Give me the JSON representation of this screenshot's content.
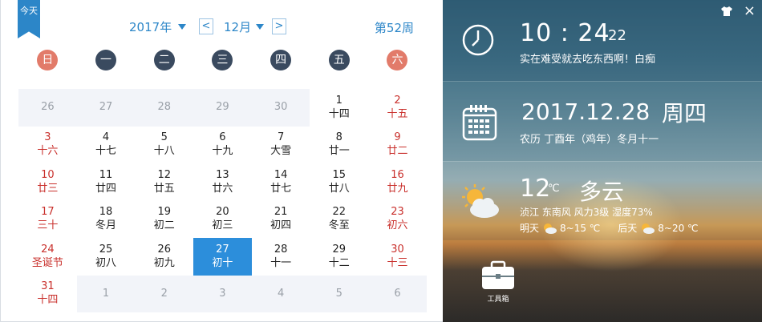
{
  "calendar": {
    "today_label": "今天",
    "year": "2017年",
    "prev": "<",
    "month": "12月",
    "next": ">",
    "week_no": "第52周",
    "weekdays": [
      "日",
      "一",
      "二",
      "三",
      "四",
      "五",
      "六"
    ],
    "cells": [
      {
        "n": "26",
        "l": "",
        "type": "other"
      },
      {
        "n": "27",
        "l": "",
        "type": "other"
      },
      {
        "n": "28",
        "l": "",
        "type": "other"
      },
      {
        "n": "29",
        "l": "",
        "type": "other"
      },
      {
        "n": "30",
        "l": "",
        "type": "other"
      },
      {
        "n": "1",
        "l": "十四",
        "type": "normal"
      },
      {
        "n": "2",
        "l": "十五",
        "type": "red"
      },
      {
        "n": "3",
        "l": "十六",
        "type": "red"
      },
      {
        "n": "4",
        "l": "十七",
        "type": "normal"
      },
      {
        "n": "5",
        "l": "十八",
        "type": "normal"
      },
      {
        "n": "6",
        "l": "十九",
        "type": "normal"
      },
      {
        "n": "7",
        "l": "大雪",
        "type": "normal"
      },
      {
        "n": "8",
        "l": "廿一",
        "type": "normal"
      },
      {
        "n": "9",
        "l": "廿二",
        "type": "red"
      },
      {
        "n": "10",
        "l": "廿三",
        "type": "red"
      },
      {
        "n": "11",
        "l": "廿四",
        "type": "normal"
      },
      {
        "n": "12",
        "l": "廿五",
        "type": "normal"
      },
      {
        "n": "13",
        "l": "廿六",
        "type": "normal"
      },
      {
        "n": "14",
        "l": "廿七",
        "type": "normal"
      },
      {
        "n": "15",
        "l": "廿八",
        "type": "normal"
      },
      {
        "n": "16",
        "l": "廿九",
        "type": "red"
      },
      {
        "n": "17",
        "l": "三十",
        "type": "red"
      },
      {
        "n": "18",
        "l": "冬月",
        "type": "normal"
      },
      {
        "n": "19",
        "l": "初二",
        "type": "normal"
      },
      {
        "n": "20",
        "l": "初三",
        "type": "normal"
      },
      {
        "n": "21",
        "l": "初四",
        "type": "normal"
      },
      {
        "n": "22",
        "l": "冬至",
        "type": "normal"
      },
      {
        "n": "23",
        "l": "初六",
        "type": "red"
      },
      {
        "n": "24",
        "l": "圣诞节",
        "type": "red"
      },
      {
        "n": "25",
        "l": "初八",
        "type": "normal"
      },
      {
        "n": "26",
        "l": "初九",
        "type": "normal"
      },
      {
        "n": "27",
        "l": "初十",
        "type": "today"
      },
      {
        "n": "28",
        "l": "十一",
        "type": "normal"
      },
      {
        "n": "29",
        "l": "十二",
        "type": "normal"
      },
      {
        "n": "30",
        "l": "十三",
        "type": "red"
      },
      {
        "n": "31",
        "l": "十四",
        "type": "red"
      },
      {
        "n": "1",
        "l": "",
        "type": "other"
      },
      {
        "n": "2",
        "l": "",
        "type": "other"
      },
      {
        "n": "3",
        "l": "",
        "type": "other"
      },
      {
        "n": "4",
        "l": "",
        "type": "other"
      },
      {
        "n": "5",
        "l": "",
        "type": "other"
      },
      {
        "n": "6",
        "l": "",
        "type": "other"
      }
    ]
  },
  "panel": {
    "skin_icon": "shirt-icon",
    "close": "×",
    "time": "10 : 24",
    "seconds": "22",
    "message": "实在难受就去吃东西啊！白痴",
    "date": "2017.12.28",
    "weekday": "周四",
    "lunar": "农历 丁酉年（鸡年）冬月十一",
    "temp": "12",
    "temp_unit": "℃",
    "condition": "多云",
    "details": "浈江  东南风  风力3级  湿度73%",
    "tomorrow_label": "明天",
    "tomorrow_range": "8~15  ℃",
    "after_label": "后天",
    "after_range": "8~20  ℃",
    "toolbox_label": "工具箱"
  }
}
